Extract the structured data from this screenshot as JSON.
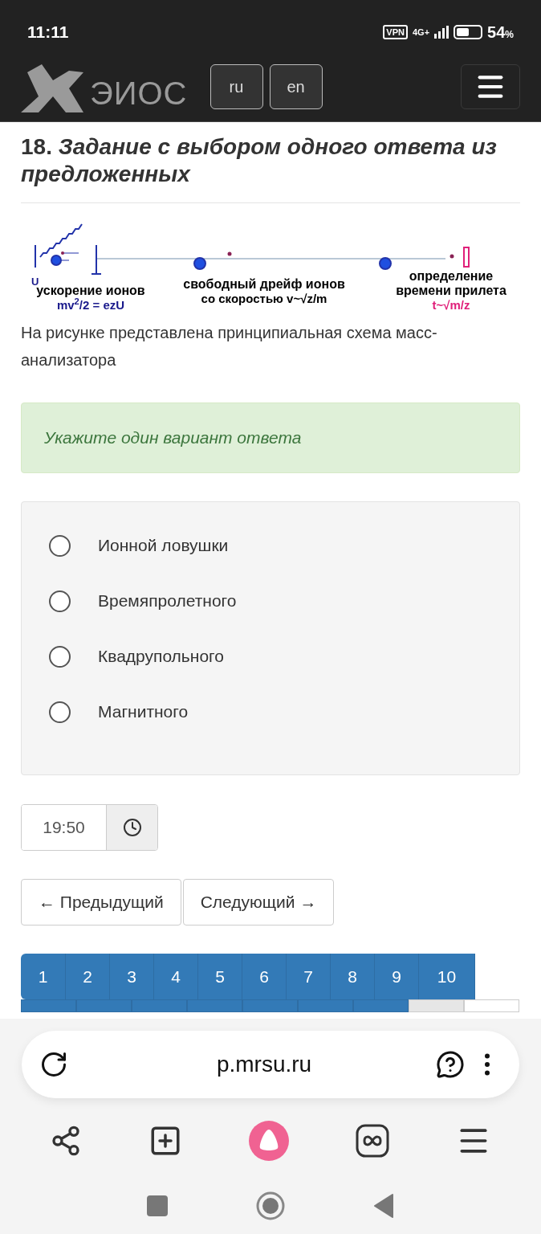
{
  "status_bar": {
    "time": "11:11",
    "vpn": "VPN",
    "network": "4G+",
    "battery_text": "54",
    "battery_unit": "%"
  },
  "header": {
    "logo": "ЭИОС",
    "languages": [
      {
        "label": "ru",
        "selected": false
      },
      {
        "label": "en",
        "selected": false
      }
    ]
  },
  "question": {
    "number": "18.",
    "title": "Задание с выбором одного ответа из предложенных",
    "diagram": {
      "voltage": "U",
      "stages": [
        {
          "label": "ускорение ионов",
          "formula": "mv$^{2}$/2 = ezU",
          "kind": "accel"
        },
        {
          "label": "свободный дрейф ионов",
          "formula": "со скоростью v~√z/m",
          "kind": "drift"
        },
        {
          "label": "определение времени прилета",
          "formula": "t~√m/z",
          "kind": "detect"
        }
      ]
    },
    "text": "На рисунке представлена принципиальная схема масс-анализатора",
    "hint": "Укажите один вариант ответа",
    "options": [
      {
        "label": "Ионной ловушки",
        "selected": false
      },
      {
        "label": "Времяпролетного",
        "selected": false
      },
      {
        "label": "Квадрупольного",
        "selected": false
      },
      {
        "label": "Магнитного",
        "selected": false
      }
    ]
  },
  "timer": "19:50",
  "nav_buttons": [
    "← Предыдущий",
    "Следующий →"
  ],
  "pagination": [
    {
      "label": "1"
    },
    {
      "label": "2"
    },
    {
      "label": "3"
    },
    {
      "label": "4"
    },
    {
      "label": "5"
    },
    {
      "label": "6"
    },
    {
      "label": "7"
    },
    {
      "label": "8"
    },
    {
      "label": "9"
    },
    {
      "label": "10"
    }
  ],
  "pagination_row_2": [
    {
      "kind": "answered"
    },
    {
      "kind": "answered"
    },
    {
      "kind": "answered"
    },
    {
      "kind": "answered"
    },
    {
      "kind": "answered"
    },
    {
      "kind": "answered"
    },
    {
      "kind": "answered"
    },
    {
      "kind": "current"
    },
    {
      "kind": "unanswered"
    }
  ],
  "browser": {
    "url": "p.mrsu.ru"
  }
}
